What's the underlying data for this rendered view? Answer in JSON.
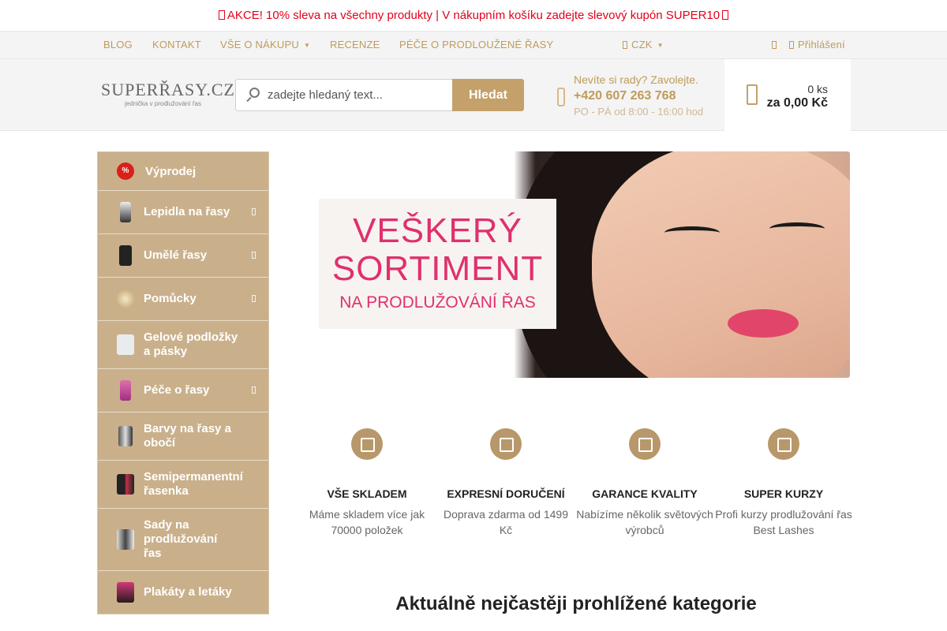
{
  "promo": {
    "text": "AKCE! 10% sleva na všechny produkty | V nákupním košíku zadejte slevový kupón SUPER10"
  },
  "topnav": {
    "items": [
      "BLOG",
      "KONTAKT",
      "VŠE O NÁKUPU",
      "RECENZE",
      "PÉČE O PRODLOUŽENÉ ŘASY"
    ],
    "currency": "CZK",
    "login": "Přihlášení"
  },
  "header": {
    "logo_name": "SUPERŘASY.CZ",
    "logo_tagline": "jednička v prodlužování řas",
    "search_placeholder": "zadejte hledaný text...",
    "search_button": "Hledat",
    "contact_line1": "Nevíte si rady? Zavolejte.",
    "contact_phone": "+420 607 263 768",
    "contact_hours": "PO - PÁ od 8:00 - 16:00 hod",
    "cart_qty": "0 ks",
    "cart_price": "za 0,00 Kč"
  },
  "sidebar": {
    "items": [
      {
        "label": "Výprodej"
      },
      {
        "label": "Lepidla na řasy"
      },
      {
        "label": "Umělé řasy"
      },
      {
        "label": "Pomůcky"
      },
      {
        "label": "Gelové podložky a pásky"
      },
      {
        "label": "Péče o řasy"
      },
      {
        "label": "Barvy na řasy a obočí"
      },
      {
        "label": "Semipermanentní řasenka"
      },
      {
        "label": "Sady na prodlužování řas"
      },
      {
        "label": "Plakáty a letáky"
      }
    ]
  },
  "banner": {
    "line1": "VEŠKERÝ",
    "line2": "SORTIMENT",
    "line3": "NA PRODLUŽOVÁNÍ ŘAS"
  },
  "features": [
    {
      "title": "VŠE SKLADEM",
      "desc": "Máme skladem více jak 70000 položek",
      "icon": "warehouse-icon"
    },
    {
      "title": "EXPRESNÍ DORUČENÍ",
      "desc": "Doprava zdarma od 1499 Kč",
      "icon": "delivery-truck-icon"
    },
    {
      "title": "GARANCE KVALITY",
      "desc": "Nabízíme několik světových výrobců",
      "icon": "award-icon"
    },
    {
      "title": "SUPER KURZY",
      "desc": "Profi kurzy prodlužování řas Best Lashes",
      "icon": "certified-icon"
    }
  ],
  "section_heading": "Aktuálně nejčastěji prohlížené kategorie",
  "colors": {
    "accent": "#c4a06a",
    "promo_red": "#e3001b",
    "sidebar_bg": "#c9b08b"
  }
}
